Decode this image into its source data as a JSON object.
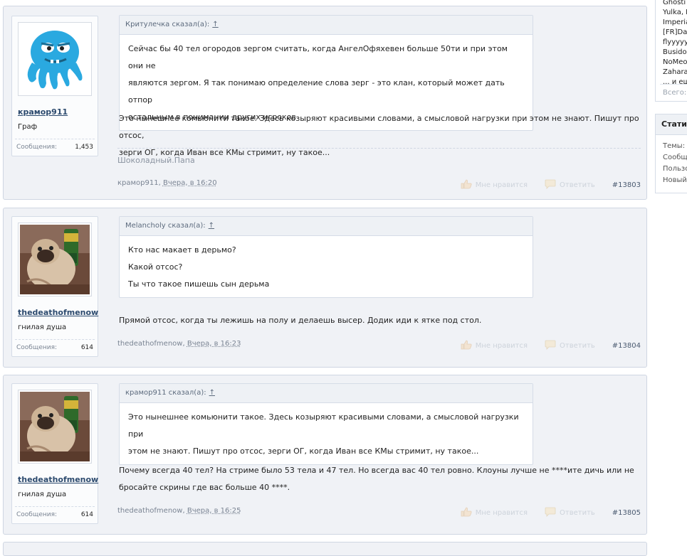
{
  "sidebar_online": {
    "names": [
      "Ghosti",
      "Yulka, I",
      "Imperia",
      "[FR]Da",
      "flyyyyy",
      "Busido,",
      "NoMeo",
      "Zahara",
      "... и ещ"
    ],
    "total_label": "Всего:"
  },
  "sidebar_stats": {
    "title": "Статис",
    "rows": [
      "Темы:",
      "Сообщ",
      "Пользо",
      "Новый"
    ]
  },
  "posts": [
    {
      "username": "крамор911",
      "user_title": "Граф",
      "stats_label": "Сообщения:",
      "stats_value": "1,453",
      "quote_author": "Критулечка сказал(а):",
      "quote_arrow": "↑",
      "quote_lines": [
        "Сейчас бы 40 тел огородов зергом считать, когда АнгелОфяхевен больше 50ти и при этом они не",
        "являются зергом. Я так понимаю определение слова зерг - это клан, который может дать отпор",
        "остальным в понимании других игроков"
      ],
      "message_lines": [
        "Это нынешнее комьюнити такое. Здесь козыряют красивыми словами, а смысловой нагрузки при этом не знают. Пишут про отсос,",
        "зерги ОГ, когда Иван все КМы стримит, ну такое..."
      ],
      "signature": "Шоколадный.Папа",
      "author_link": "крамор911",
      "date": "Вчера, в 16:20",
      "like_label": "Мне нравится",
      "reply_label": "Ответить",
      "post_number": "#13803"
    },
    {
      "username": "thedeathofmenow",
      "user_title": "гнилая душа",
      "stats_label": "Сообщения:",
      "stats_value": "614",
      "quote_author": "Melancholy сказал(а):",
      "quote_arrow": "↑",
      "quote_lines": [
        "Кто нас макает в дерьмо?",
        "Какой отсос?",
        "Ты что такое пишешь сын дерьма"
      ],
      "message_lines": [
        "Прямой отсос, когда ты лежишь на полу и делаешь высер. Додик иди к ятке под стол."
      ],
      "author_link": "thedeathofmenow",
      "date": "Вчера, в 16:23",
      "like_label": "Мне нравится",
      "reply_label": "Ответить",
      "post_number": "#13804"
    },
    {
      "username": "thedeathofmenow",
      "user_title": "гнилая душа",
      "stats_label": "Сообщения:",
      "stats_value": "614",
      "quote_author": "крамор911 сказал(а):",
      "quote_arrow": "↑",
      "quote_lines": [
        "Это нынешнее комьюнити такое. Здесь козыряют красивыми словами, а смысловой нагрузки при",
        "этом не знают. Пишут про отсос, зерги ОГ, когда Иван все КМы стримит, ну такое..."
      ],
      "message_lines": [
        "Почему всегда 40 тел? На стриме было 53 тела и 47 тел. Но всегда вас 40 тел ровно. Клоуны лучше не ****ите дичь или не",
        "бросайте скрины где вас больше 40 ****."
      ],
      "author_link": "thedeathofmenow",
      "date": "Вчера, в 16:25",
      "like_label": "Мне нравится",
      "reply_label": "Ответить",
      "post_number": "#13805"
    }
  ]
}
